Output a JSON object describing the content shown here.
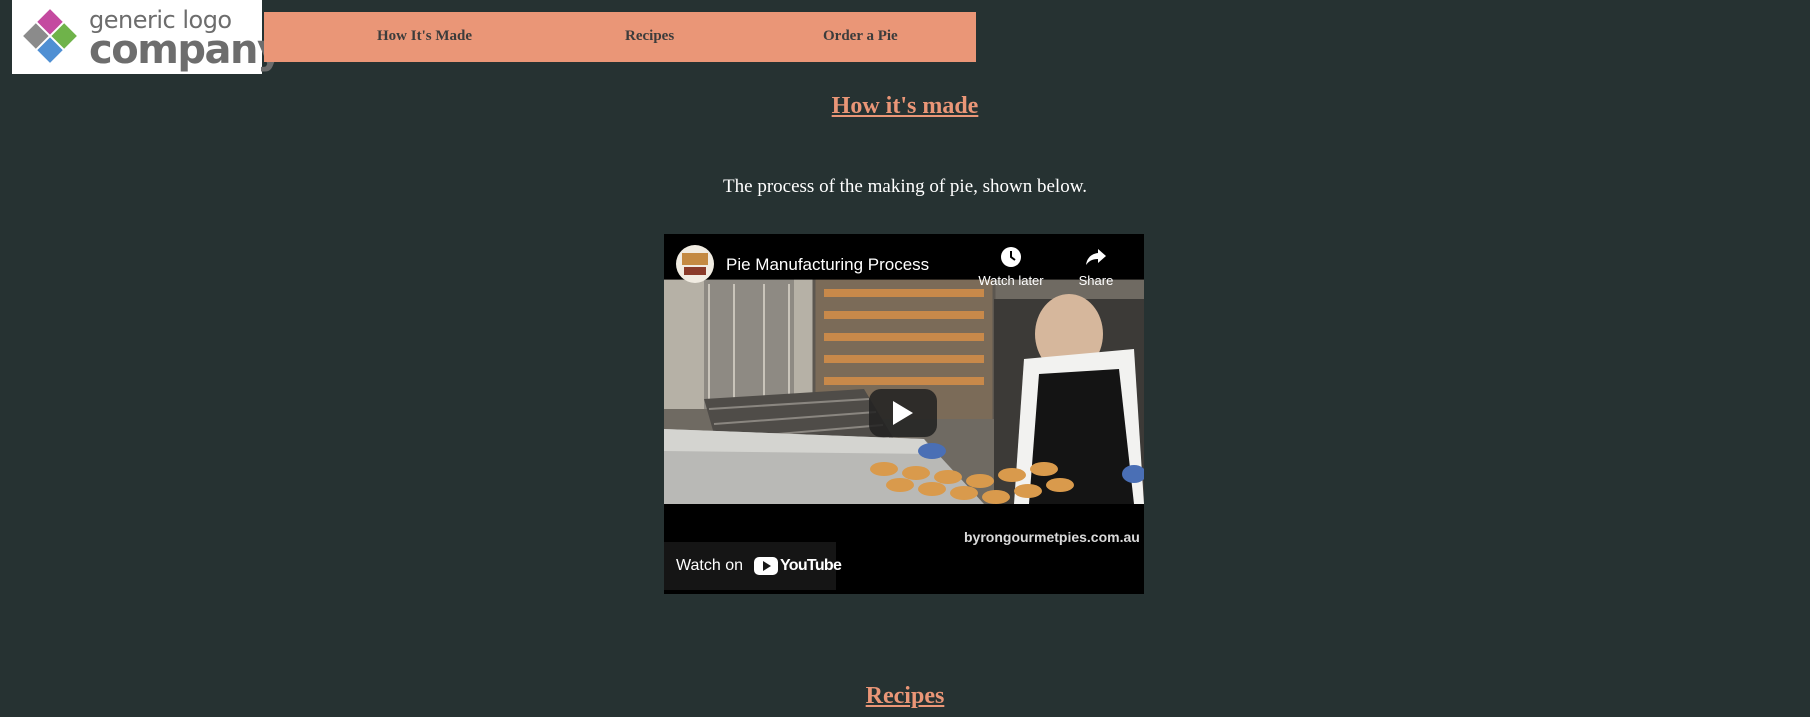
{
  "logo": {
    "line1": "generic logo",
    "line2": "company"
  },
  "nav": {
    "items": [
      {
        "label": "How It's Made"
      },
      {
        "label": "Recipes"
      },
      {
        "label": "Order a Pie"
      }
    ]
  },
  "main": {
    "section1_title": "How it's made",
    "intro_text": "The process of the making of pie, shown below.",
    "video": {
      "title": "Pie Manufacturing Process",
      "watch_later_label": "Watch later",
      "share_label": "Share",
      "watermark": "byrongourmetpies.com.au",
      "watch_on_label": "Watch on",
      "youtube_label": "YouTube"
    },
    "section2_title": "Recipes"
  },
  "colors": {
    "background": "#263232",
    "accent": "#ea9677",
    "nav_text": "#3c3c3c"
  }
}
